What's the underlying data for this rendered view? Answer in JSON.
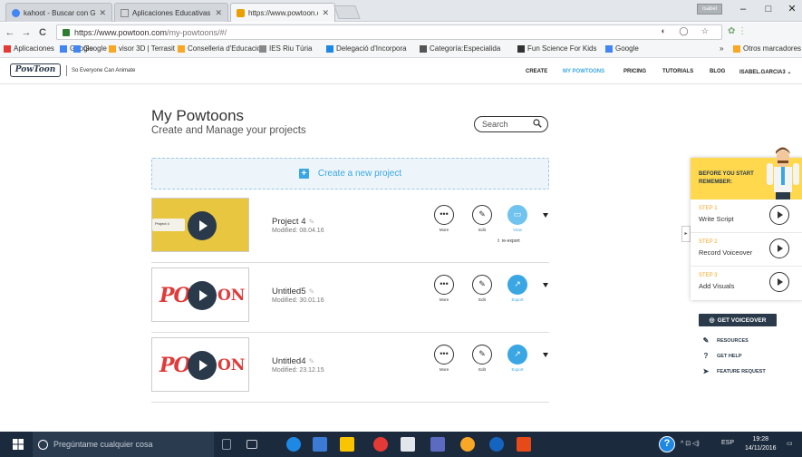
{
  "browser": {
    "tabs": [
      {
        "title": "kahoot - Buscar con Goo",
        "favicon_color": "#4285f4"
      },
      {
        "title": "Aplicaciones Educativas",
        "favicon_color": "#888888"
      },
      {
        "title": "https://www.powtoon.co",
        "favicon_color": "#e8a000"
      }
    ],
    "user_badge": "Isabel",
    "window_controls": [
      "–",
      "□",
      "✕"
    ],
    "url_host": "https://www.powtoon.com",
    "url_path": "/my-powtoons/#/",
    "nav": {
      "back": "←",
      "forward": "→",
      "reload": "C"
    },
    "omni_icons": "◐ ◯ ☆"
  },
  "bookmarks": [
    {
      "label": "Aplicaciones",
      "color": "#e53935"
    },
    {
      "label": "Google",
      "color": "#4285f4"
    },
    {
      "label": "Google",
      "color": "#4285f4"
    },
    {
      "label": "visor 3D | Terrasit",
      "color": "#f9a825"
    },
    {
      "label": "Conselleria d'Educacio",
      "color": "#f9a825"
    },
    {
      "label": "IES Riu Túria",
      "color": "#888888"
    },
    {
      "label": "Delegació d'Incorpora",
      "color": "#1e88e5"
    },
    {
      "label": "Categoría:Especialida",
      "color": "#555555"
    },
    {
      "label": "Fun Science For Kids",
      "color": "#333333"
    },
    {
      "label": "Google",
      "color": "#4285f4"
    },
    {
      "label": "»",
      "color": ""
    },
    {
      "label": "Otros marcadores",
      "color": "#f9a825"
    }
  ],
  "powtoon": {
    "logo": "PowToon",
    "tagline": "So Everyone Can Animate",
    "nav": [
      "CREATE",
      "MY POWTOONS",
      "PRICING",
      "TUTORIALS",
      "BLOG",
      "ISABEL.GARCIA3 ⌄"
    ],
    "active_nav": "MY POWTOONS",
    "page_title": "My Powtoons",
    "page_subtitle": "Create and Manage your projects",
    "search_placeholder": "Search",
    "create_label": "Create a new project"
  },
  "projects": [
    {
      "name": "Project 4",
      "modified": "Modified: 08.04.16",
      "thumb": "cover",
      "third_action": "View",
      "extra": "re-export"
    },
    {
      "name": "Untitled5",
      "modified": "Modified: 30.01.16",
      "thumb": "logo",
      "third_action": "Export",
      "extra": ""
    },
    {
      "name": "Untitled4",
      "modified": "Modified: 23.12.15",
      "thumb": "logo",
      "third_action": "Export",
      "extra": ""
    }
  ],
  "actions": {
    "more": "More",
    "edit": "Edit"
  },
  "thumb_text": {
    "pow_left": "PO",
    "pow_right": "ON",
    "hand_text": "Project 4"
  },
  "side_panel": {
    "header": "BEFORE YOU START REMEMBER:",
    "steps": [
      {
        "num": "STEP 1",
        "title": "Write Script"
      },
      {
        "num": "STEP 2",
        "title": "Record Voiceover"
      },
      {
        "num": "STEP 3",
        "title": "Add Visuals"
      }
    ],
    "voiceover_button": "GET VOICEOVER",
    "links": [
      {
        "label": "RESOURCES",
        "icon": "✎"
      },
      {
        "label": "GET HELP",
        "icon": "?"
      },
      {
        "label": "FEATURE REQUEST",
        "icon": "➤"
      }
    ]
  },
  "taskbar": {
    "search_placeholder": "Pregúntame cualquier cosa",
    "language": "ESP",
    "time": "19:28",
    "date": "14/11/2016"
  }
}
